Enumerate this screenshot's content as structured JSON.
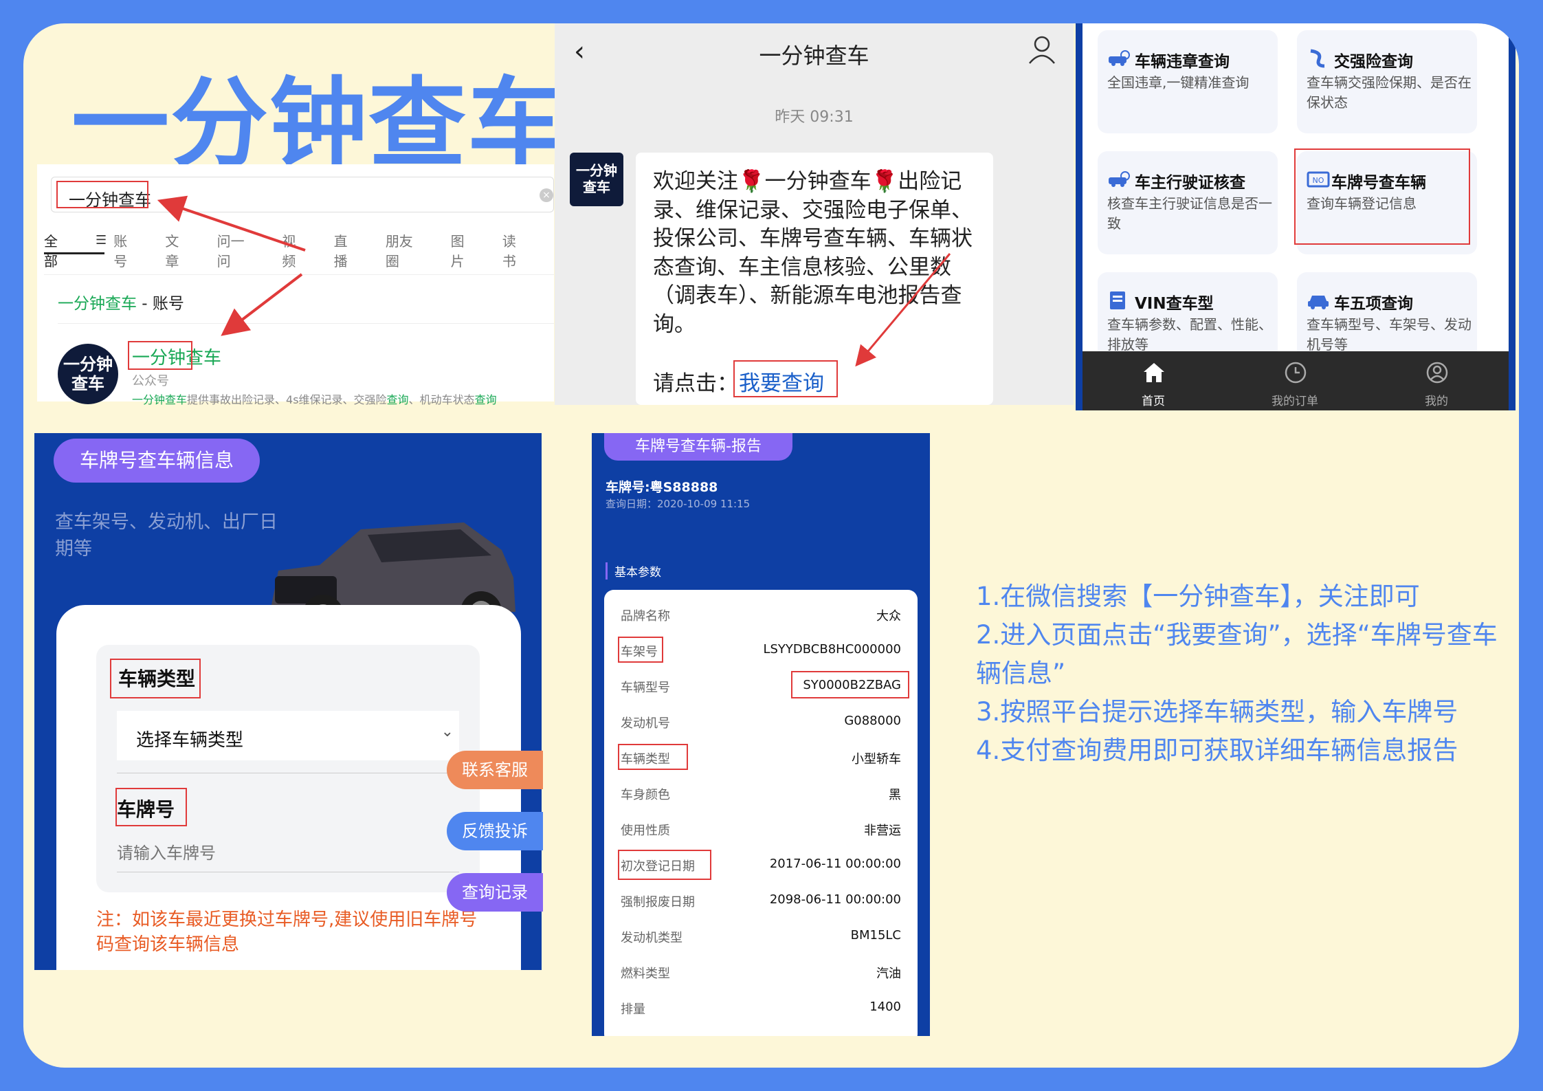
{
  "title": "一分钟查车",
  "search_panel": {
    "query": "一分钟查车",
    "tabs": [
      "全部",
      "账号",
      "文章",
      "问一问",
      "视频",
      "直播",
      "朋友圈",
      "图片",
      "读书"
    ],
    "result_title_green": "一分钟查车",
    "result_title_dark": " - 账号",
    "avatar_text": "一分钟查车",
    "account_name": "一分钟查车",
    "account_type": "公众号",
    "desc_green": "一分钟查车",
    "desc_rest": "提供事故出险记录、4s维保记录、交强险",
    "desc_green2": "查询",
    "desc_rest2": "、机动车状态",
    "desc_green3": "查询"
  },
  "chat_panel": {
    "title": "一分钟查车",
    "time": "昨天 09:31",
    "avatar_text": "一分钟查车",
    "message": "欢迎关注🌹一分钟查车🌹出险记录、维保记录、交强险电子保单、投保公司、车牌号查车辆、车辆状态查询、车主信息核验、公里数（调表车）、新能源车电池报告查询。",
    "cta_label": "请点击：",
    "cta_link": "我要查询"
  },
  "service_panel": {
    "tiles": [
      {
        "name": "车辆违章查询",
        "desc": "全国违章,一键精准查询",
        "icon": "car-search-icon"
      },
      {
        "name": "交强险查询",
        "desc": "查车辆交强险保期、是否在保状态",
        "icon": "insurance-icon"
      },
      {
        "name": "车主行驶证核查",
        "desc": "核查车主行驶证信息是否一致",
        "icon": "car-search-icon"
      },
      {
        "name": "车牌号查车辆",
        "desc": "查询车辆登记信息",
        "icon": "plate-icon"
      },
      {
        "name": "VIN查车型",
        "desc": "查车辆参数、配置、性能、排放等",
        "icon": "document-icon"
      },
      {
        "name": "车五项查询",
        "desc": "查车辆型号、车架号、发动机号等",
        "icon": "car-icon"
      }
    ],
    "nav": [
      {
        "label": "首页",
        "icon": "home-icon"
      },
      {
        "label": "我的订单",
        "icon": "clock-icon"
      },
      {
        "label": "我的",
        "icon": "user-icon"
      }
    ]
  },
  "form_panel": {
    "pill": "车牌号查车辆信息",
    "subtitle": "查车架号、发动机、出厂日期等",
    "vehicle_type_label": "车辆类型",
    "vehicle_type_placeholder": "选择车辆类型",
    "plate_label": "车牌号",
    "plate_placeholder": "请输入车牌号",
    "note": "注：如该车最近更换过车牌号,建议使用旧车牌号码查询该车辆信息",
    "float_buttons": [
      "联系客服",
      "反馈投诉",
      "查询记录"
    ]
  },
  "report_panel": {
    "pill": "车牌号查车辆-报告",
    "plate": "车牌号:粤S88888",
    "date": "查询日期：2020-10-09 11:15",
    "section": "基本参数",
    "rows": [
      {
        "k": "品牌名称",
        "v": "大众"
      },
      {
        "k": "车架号",
        "v": "LSYYDBCB8HC000000"
      },
      {
        "k": "车辆型号",
        "v": "SY0000B2ZBAG"
      },
      {
        "k": "发动机号",
        "v": "G088000"
      },
      {
        "k": "车辆类型",
        "v": "小型轿车"
      },
      {
        "k": "车身颜色",
        "v": "黑"
      },
      {
        "k": "使用性质",
        "v": "非营运"
      },
      {
        "k": "初次登记日期",
        "v": "2017-06-11 00:00:00"
      },
      {
        "k": "强制报废日期",
        "v": "2098-06-11 00:00:00"
      },
      {
        "k": "发动机类型",
        "v": "BM15LC"
      },
      {
        "k": "燃料类型",
        "v": "汽油"
      },
      {
        "k": "排量",
        "v": "1400"
      }
    ]
  },
  "steps": [
    "1.在微信搜索【一分钟查车】，关注即可",
    "2.进入页面点击“我要查询”，选择“车牌号查车辆信息”",
    "3.按照平台提示选择车辆类型，输入车牌号",
    "4.支付查询费用即可获取详细车辆信息报告"
  ],
  "colors": {
    "accent": "#4f86ef",
    "navy": "#0e3fa4",
    "purple": "#8667f3",
    "green": "#19a855",
    "red": "#e03a3a",
    "orange": "#e85b24"
  }
}
